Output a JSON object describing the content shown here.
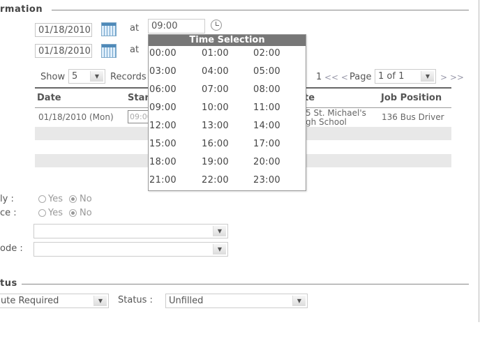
{
  "section_information": {
    "legend": "rmation"
  },
  "dates": {
    "start_date": "01/18/2010",
    "end_date": "01/18/2010",
    "at_label": "at",
    "start_time": "09:00"
  },
  "time_popup": {
    "title": "Time Selection",
    "times": [
      "00:00",
      "01:00",
      "02:00",
      "03:00",
      "04:00",
      "05:00",
      "06:00",
      "07:00",
      "08:00",
      "09:00",
      "10:00",
      "11:00",
      "12:00",
      "13:00",
      "14:00",
      "15:00",
      "16:00",
      "17:00",
      "18:00",
      "19:00",
      "20:00",
      "21:00",
      "22:00",
      "23:00"
    ]
  },
  "records": {
    "show_label": "Show",
    "count": "5",
    "records_label": "Records"
  },
  "pager": {
    "first_num": "1",
    "prev_links": "<< <",
    "page_label": "Page",
    "page_value": "1 of 1",
    "next_links": "> >>"
  },
  "table": {
    "headers": {
      "date": "Date",
      "start": "Star",
      "location": "te",
      "job_position": "Job Position"
    },
    "rows": [
      {
        "date": "01/18/2010 (Mon)",
        "start_time": "09:00",
        "location_line1": "5 St. Michael's",
        "location_line2": "gh School",
        "job_position": "136 Bus Driver"
      }
    ]
  },
  "options": {
    "q1_label": "ly :",
    "q2_label": "ce :",
    "yes": "Yes",
    "no": "No",
    "q1_selected": "No",
    "q2_selected": "No",
    "code_label": "ode :",
    "select1_value": "",
    "select2_value": ""
  },
  "section_status": {
    "legend": "tus"
  },
  "status_row": {
    "substitute_value": "ute Required",
    "status_label": "Status :",
    "status_value": "Unfilled"
  }
}
